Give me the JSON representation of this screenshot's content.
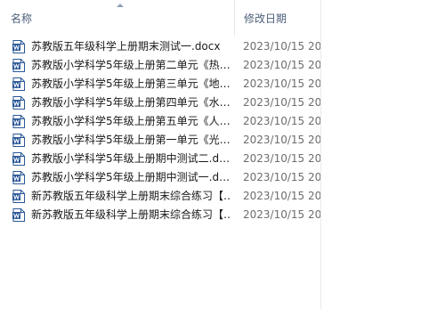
{
  "columns": {
    "name_label": "名称",
    "date_label": "修改日期"
  },
  "sort": {
    "column": "name",
    "direction": "ascending"
  },
  "file_icon": "word-document-icon",
  "colors": {
    "icon_blue": "#2b5797",
    "header_text": "#4c607a",
    "date_text": "#6d6d6d"
  },
  "files": [
    {
      "name": "苏教版五年级科学上册期末测试一.docx",
      "date": "2023/10/15 20"
    },
    {
      "name": "苏教版小学科学5年级上册第二单元《热…",
      "date": "2023/10/15 20"
    },
    {
      "name": "苏教版小学科学5年级上册第三单元《地…",
      "date": "2023/10/15 20"
    },
    {
      "name": "苏教版小学科学5年级上册第四单元《水…",
      "date": "2023/10/15 20"
    },
    {
      "name": "苏教版小学科学5年级上册第五单元《人…",
      "date": "2023/10/15 20"
    },
    {
      "name": "苏教版小学科学5年级上册第一单元《光…",
      "date": "2023/10/15 20"
    },
    {
      "name": "苏教版小学科学5年级上册期中测试二.d…",
      "date": "2023/10/15 20"
    },
    {
      "name": "苏教版小学科学5年级上册期中测试一.d…",
      "date": "2023/10/15 20"
    },
    {
      "name": "新苏教版五年级科学上册期末综合练习【…",
      "date": "2023/10/15 20"
    },
    {
      "name": "新苏教版五年级科学上册期末综合练习【…",
      "date": "2023/10/15 20"
    }
  ]
}
